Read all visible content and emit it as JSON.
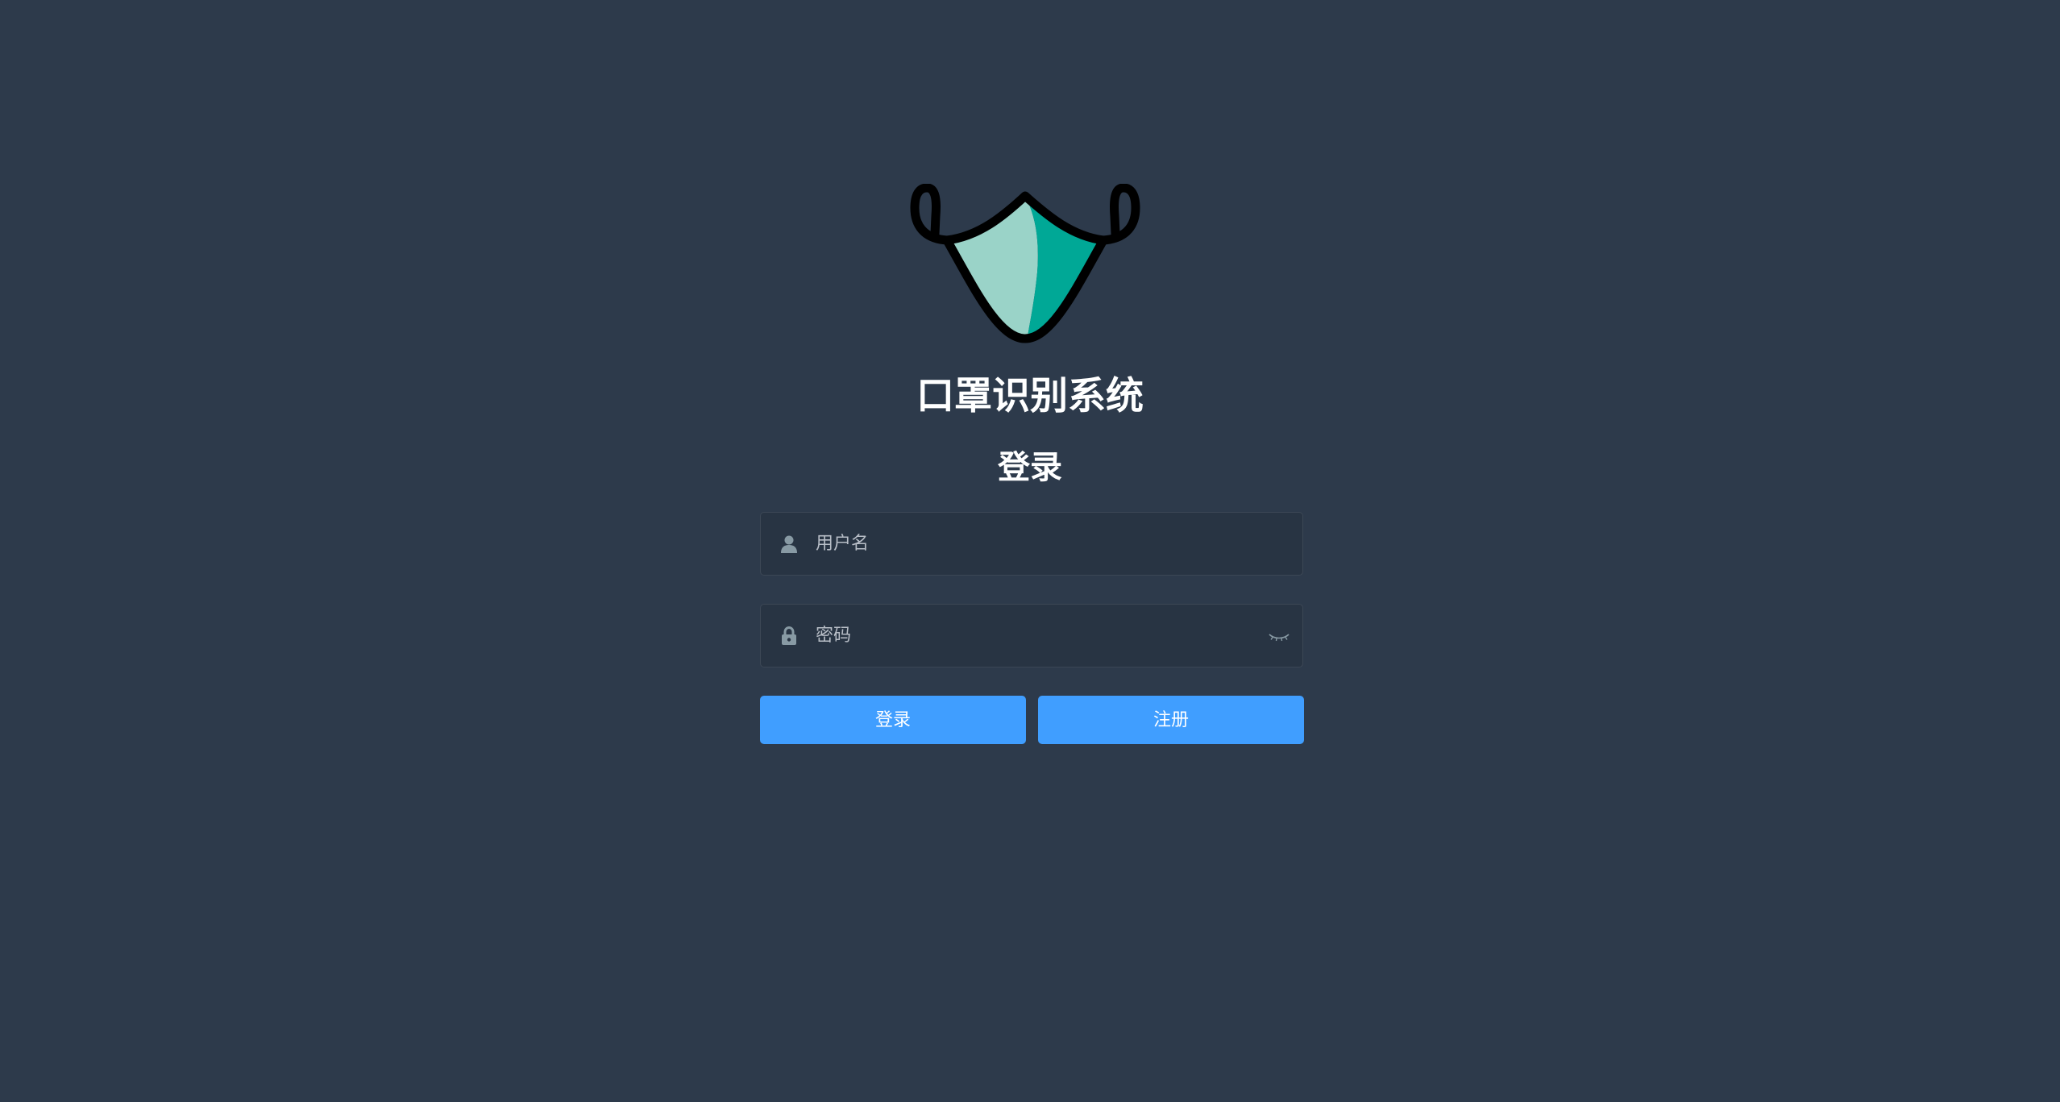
{
  "header": {
    "app_title": "口罩识别系统",
    "form_title": "登录",
    "logo_icon": "face-mask-icon"
  },
  "form": {
    "username": {
      "placeholder": "用户名",
      "value": "",
      "icon": "user-icon"
    },
    "password": {
      "placeholder": "密码",
      "value": "",
      "icon": "lock-icon",
      "toggle_icon": "eye-closed-icon"
    },
    "login_label": "登录",
    "register_label": "注册"
  },
  "colors": {
    "background": "#2d3a4b",
    "primary": "#409eff",
    "mask_light": "#9ad3c8",
    "mask_dark": "#00a896"
  }
}
